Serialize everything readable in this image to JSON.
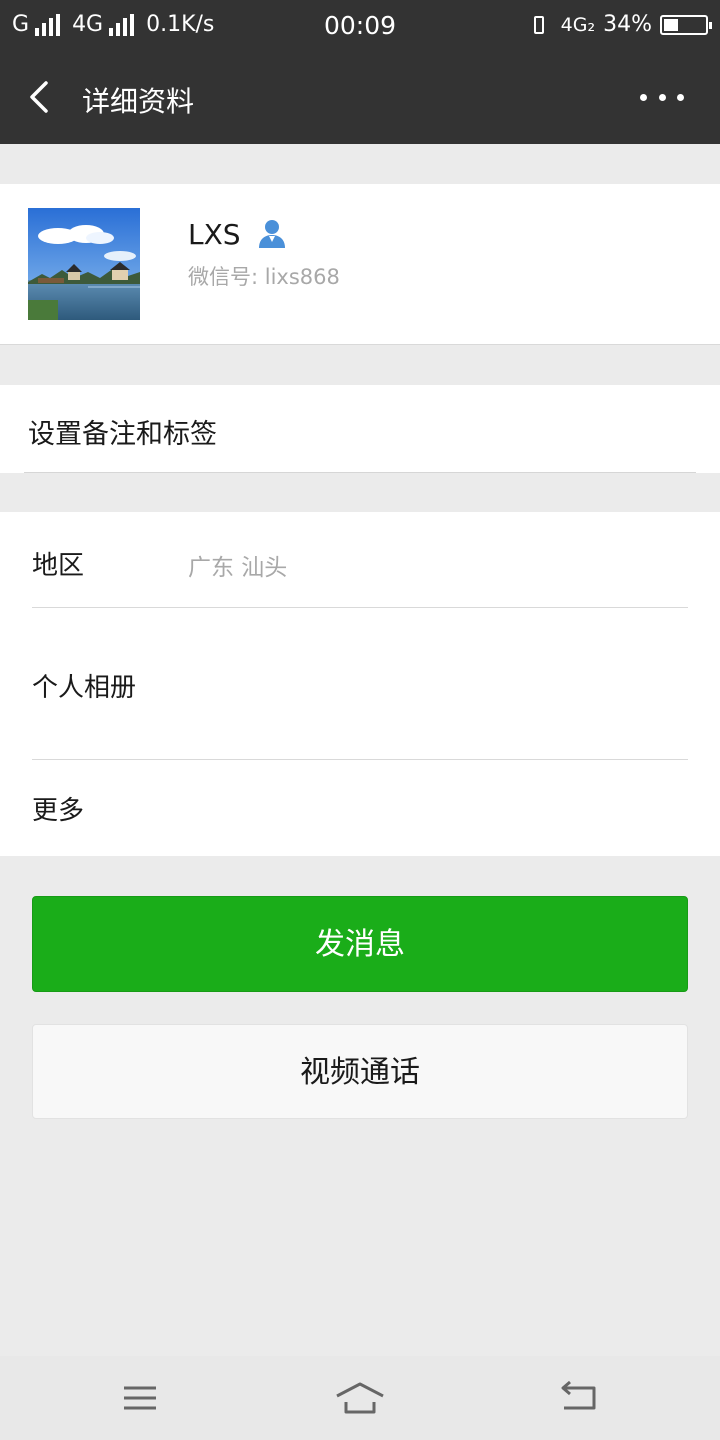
{
  "status_bar": {
    "carrier1": "G",
    "carrier2": "4G",
    "speed": "0.1K/s",
    "time": "00:09",
    "network_right": "4G₂",
    "battery_text": "34%",
    "battery_level": 0.34
  },
  "header": {
    "title": "详细资料",
    "back_icon": "chevron-left-icon",
    "more_icon": "more-dots-icon"
  },
  "profile": {
    "name": "LXS",
    "wechat_id": "微信号: lixs868",
    "contact_icon": "person-icon",
    "accent_color": "#4a90d9"
  },
  "remark": {
    "label": "设置备注和标签"
  },
  "info": {
    "region_label": "地区",
    "region_value": "广东  汕头",
    "album_label": "个人相册",
    "more_label": "更多"
  },
  "actions": {
    "send_message": "发消息",
    "video_call": "视频通话",
    "primary_color": "#1aad19"
  },
  "nav_bar": {
    "menu_icon": "menu-icon",
    "home_icon": "home-icon",
    "back_icon": "return-icon"
  }
}
